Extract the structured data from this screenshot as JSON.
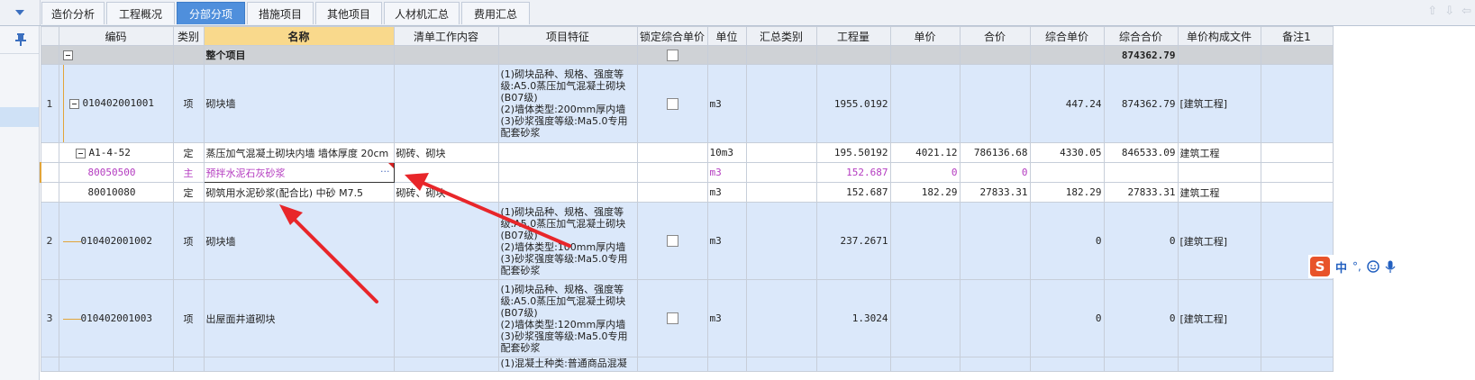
{
  "tabs": [
    "造价分析",
    "工程概况",
    "分部分项",
    "措施项目",
    "其他项目",
    "人材机汇总",
    "费用汇总"
  ],
  "active_tab": "分部分项",
  "columns": [
    "编码",
    "类别",
    "名称",
    "清单工作内容",
    "项目特征",
    "锁定综合单价",
    "单位",
    "汇总类别",
    "工程量",
    "单价",
    "合价",
    "综合单价",
    "综合合价",
    "单价构成文件",
    "备注1"
  ],
  "rows": [
    {
      "no": "",
      "code": "",
      "type": "",
      "name": "整个项目",
      "work": "",
      "feature": "",
      "locked": false,
      "unit": "",
      "sumcat": "",
      "qty": "",
      "price": "",
      "amount": "",
      "unit_total": "",
      "total": "874362.79",
      "file": "",
      "note": ""
    },
    {
      "no": "1",
      "code": "010402001001",
      "type": "项",
      "name": "砌块墙",
      "work": "",
      "feature": [
        "(1)砌块品种、规格、强度等",
        "级:A5.0蒸压加气混凝土砌块",
        "(B07级)",
        "(2)墙体类型:200mm厚内墙",
        "(3)砂浆强度等级:Ma5.0专用",
        "配套砂浆"
      ],
      "locked": false,
      "unit": "m3",
      "sumcat": "",
      "qty": "1955.0192",
      "price": "",
      "amount": "",
      "unit_total": "447.24",
      "total": "874362.79",
      "file": "[建筑工程]",
      "note": ""
    },
    {
      "no": "",
      "code": "A1-4-52",
      "type": "定",
      "name": "蒸压加气混凝土砌块内墙 墙体厚度 20cm",
      "work": "砌砖、砌块",
      "feature": "",
      "locked": null,
      "unit": "10m3",
      "sumcat": "",
      "qty": "195.50192",
      "price": "4021.12",
      "amount": "786136.68",
      "unit_total": "4330.05",
      "total": "846533.09",
      "file": "建筑工程",
      "note": ""
    },
    {
      "no": "",
      "code": "80050500",
      "type": "主",
      "name": "预拌水泥石灰砂浆",
      "work": "",
      "feature": "",
      "locked": null,
      "unit": "m3",
      "sumcat": "",
      "qty": "152.687",
      "price": "0",
      "amount": "0",
      "unit_total": "",
      "total": "",
      "file": "",
      "note": ""
    },
    {
      "no": "",
      "code": "80010080",
      "type": "定",
      "name": "砌筑用水泥砂浆(配合比) 中砂 M7.5",
      "work": "砌砖、砌块",
      "feature": "",
      "locked": null,
      "unit": "m3",
      "sumcat": "",
      "qty": "152.687",
      "price": "182.29",
      "amount": "27833.31",
      "unit_total": "182.29",
      "total": "27833.31",
      "file": "建筑工程",
      "note": ""
    },
    {
      "no": "2",
      "code": "010402001002",
      "type": "项",
      "name": "砌块墙",
      "work": "",
      "feature": [
        "(1)砌块品种、规格、强度等",
        "级:A5.0蒸压加气混凝土砌块",
        "(B07级)",
        "(2)墙体类型:100mm厚内墙",
        "(3)砂浆强度等级:Ma5.0专用",
        "配套砂浆"
      ],
      "locked": false,
      "unit": "m3",
      "sumcat": "",
      "qty": "237.2671",
      "price": "",
      "amount": "",
      "unit_total": "0",
      "total": "0",
      "file": "[建筑工程]",
      "note": ""
    },
    {
      "no": "3",
      "code": "010402001003",
      "type": "项",
      "name": "出屋面井道砌块",
      "work": "",
      "feature": [
        "(1)砌块品种、规格、强度等",
        "级:A5.0蒸压加气混凝土砌块",
        "(B07级)",
        "(2)墙体类型:120mm厚内墙",
        "(3)砂浆强度等级:Ma5.0专用",
        "配套砂浆"
      ],
      "locked": false,
      "unit": "m3",
      "sumcat": "",
      "qty": "1.3024",
      "price": "",
      "amount": "",
      "unit_total": "0",
      "total": "0",
      "file": "[建筑工程]",
      "note": ""
    },
    {
      "no": "",
      "code": "",
      "type": "",
      "name": "",
      "work": "",
      "feature": [
        "(1)混凝土种类:普通商品混凝"
      ],
      "locked": null,
      "unit": "",
      "sumcat": "",
      "qty": "",
      "price": "",
      "amount": "",
      "unit_total": "",
      "total": "",
      "file": "",
      "note": ""
    }
  ],
  "ime": {
    "char": "中",
    "punct": "°,"
  },
  "colors": {
    "active_tab": "#4f8fdc",
    "name_header": "#f9d98c",
    "list_row": "#dbe8fa",
    "total_row": "#cfd2d6",
    "material_text": "#b43bc0",
    "arrow": "#e8262a",
    "ime_logo": "#e8532a"
  }
}
